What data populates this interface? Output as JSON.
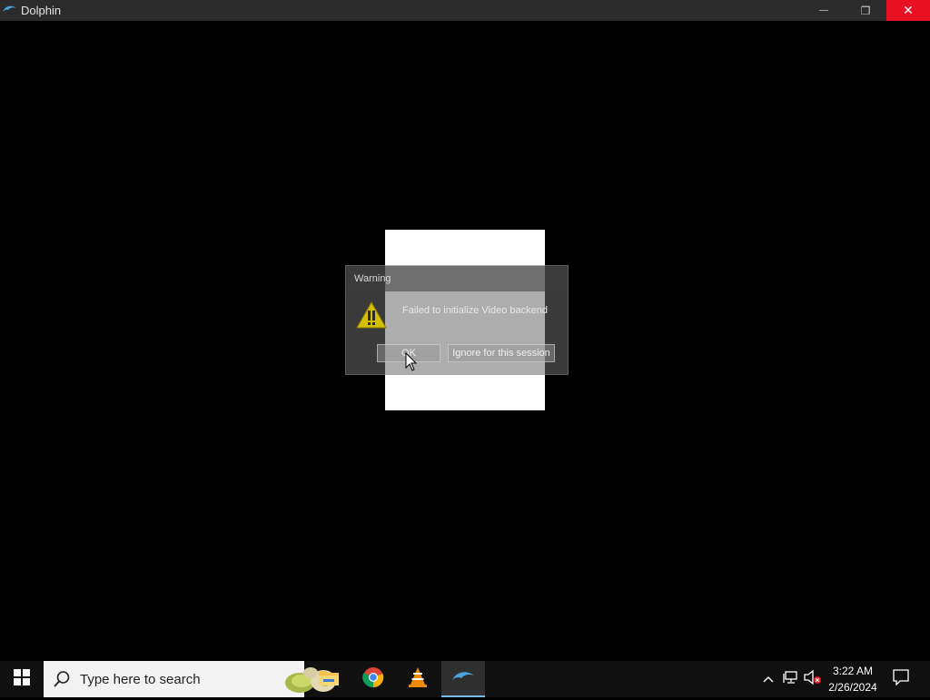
{
  "window": {
    "title": "Dolphin",
    "minimize_glyph": "—",
    "restore_glyph": "❐",
    "close_glyph": "✕"
  },
  "dialog": {
    "title": "Warning",
    "message": "Failed to initialize Video backend",
    "ok_label": "OK",
    "ignore_label": "Ignore for this session",
    "icon": "warning-icon"
  },
  "taskbar": {
    "search_placeholder": "Type here to search",
    "apps": [
      "file-explorer-icon",
      "chrome-icon",
      "vlc-icon",
      "dolphin-icon"
    ],
    "tray_chevron": "^",
    "time": "3:22 AM",
    "date": "2/26/2024"
  },
  "colors": {
    "close_button": "#e81123",
    "active_underline": "#76b9ed",
    "warning": "#d4c000"
  }
}
